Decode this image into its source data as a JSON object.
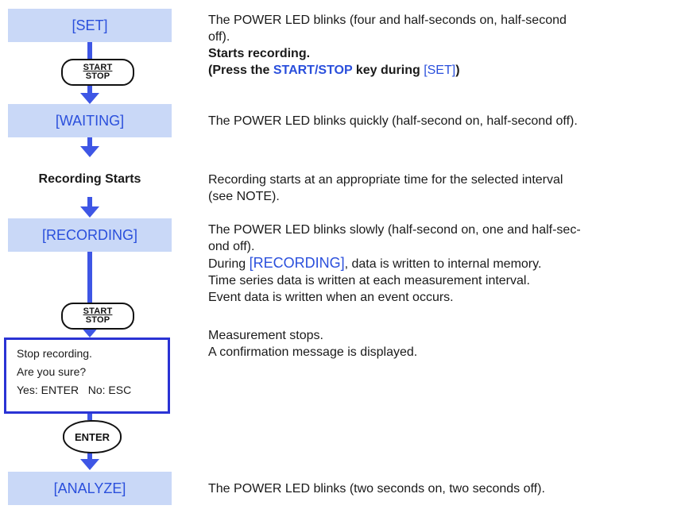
{
  "states": {
    "set": "[SET]",
    "waiting": "[WAITING]",
    "recording": "[RECORDING]",
    "analyze": "[ANALYZE]"
  },
  "keys": {
    "start_top": "START",
    "start_bottom": "STOP",
    "enter": "ENTER"
  },
  "recording_starts": "Recording Starts",
  "dialog": {
    "line1": "Stop recording.",
    "line2": "Are you sure?",
    "yes": "Yes: ENTER",
    "no": "No: ESC"
  },
  "desc": {
    "set_line1": "The POWER LED blinks (four and half-seconds on, half-second",
    "set_line2": "off).",
    "starts_recording": "Starts recording.",
    "press_pre": "(Press the ",
    "press_key": "START/STOP",
    "press_mid": " key during ",
    "press_state": "[SET]",
    "press_post": ")",
    "waiting": "The POWER LED blinks quickly (half-second on, half-second off).",
    "rec_starts_line1": "Recording starts at an appropriate time for the selected interval",
    "rec_starts_line2": "(see NOTE).",
    "recording_line1": "The POWER LED blinks slowly (half-second on, one and half-sec-",
    "recording_line2": "ond off).",
    "during_pre": "During ",
    "during_state": "[RECORDING]",
    "during_post": ", data is written to internal memory.",
    "time_series": "Time series data is written at each measurement interval.",
    "event_data": "Event data is written when an event occurs.",
    "meas_stops": "Measurement stops.",
    "confirm": "A confirmation message is displayed.",
    "analyze": "The POWER LED blinks (two seconds on, two seconds off)."
  },
  "colors": {
    "state_fill": "#c9d8f7",
    "state_text": "#2a4fdc",
    "flow_line": "#3e56e5",
    "dialog_border": "#2a33d4"
  }
}
